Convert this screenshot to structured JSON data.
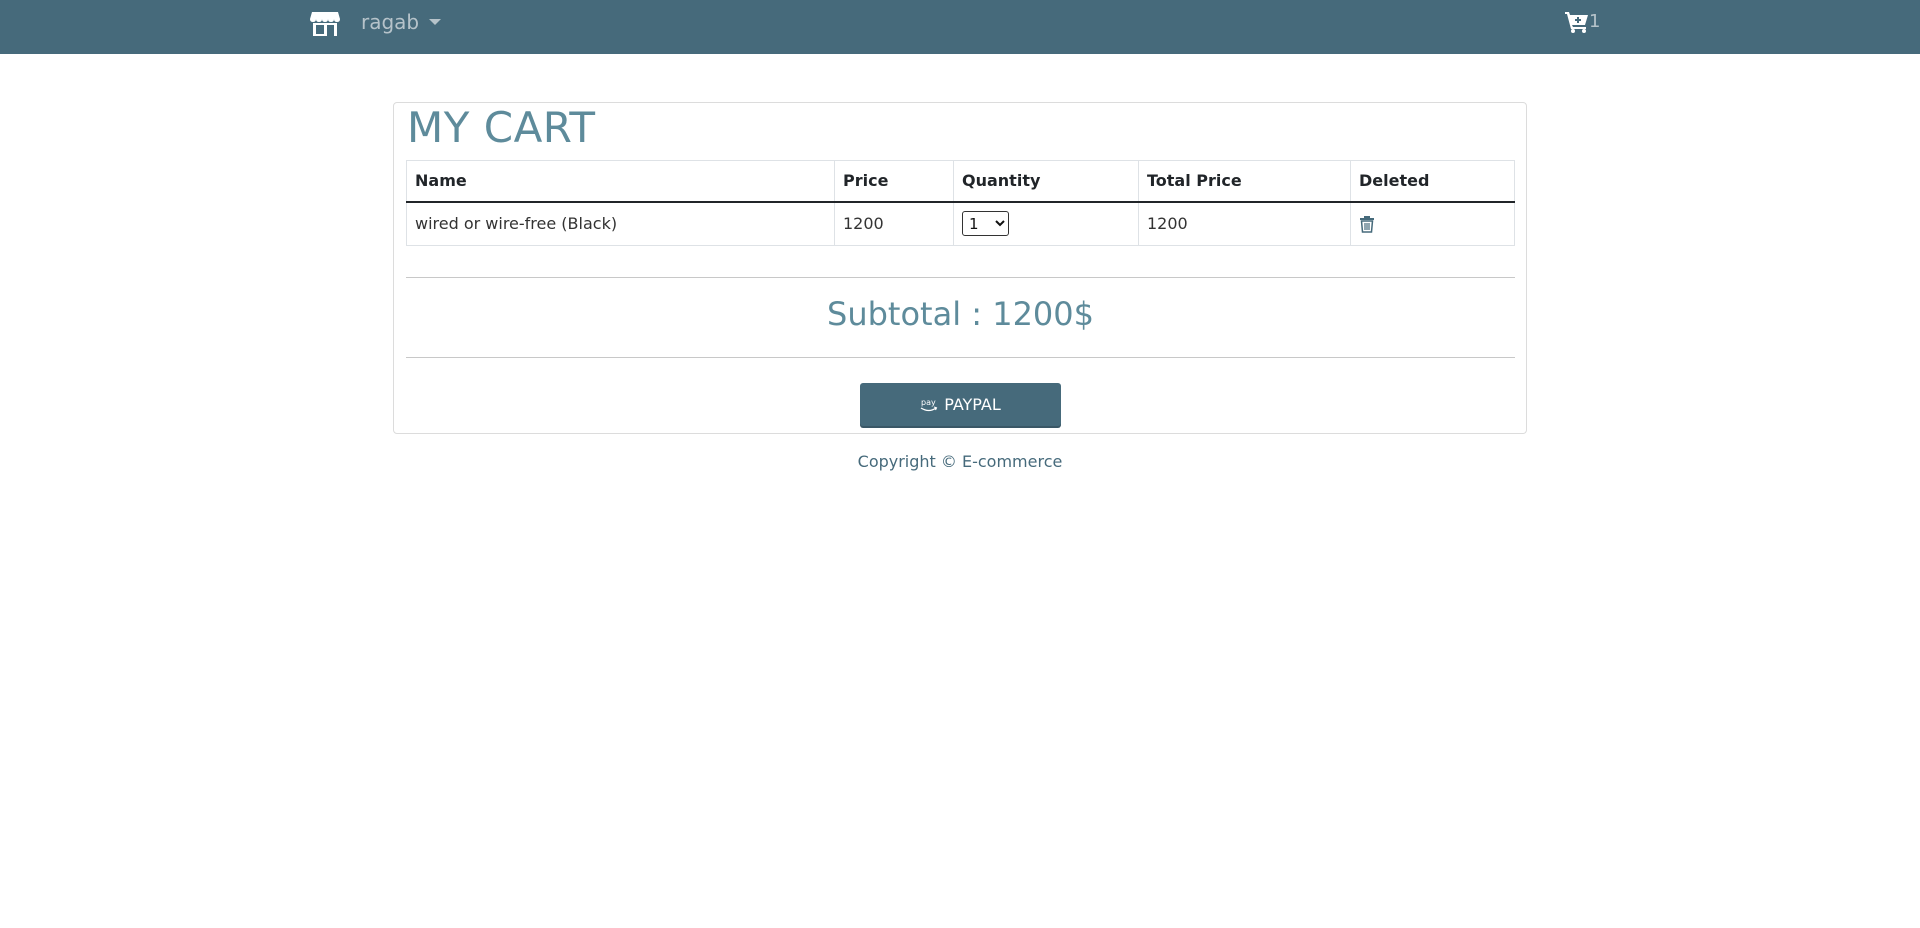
{
  "navbar": {
    "brand_icon": "store-icon",
    "user_name": "ragab",
    "cart_icon": "shopping-cart-icon",
    "cart_count": "1"
  },
  "cart": {
    "title": "MY CART",
    "columns": [
      "Name",
      "Price",
      "Quantity",
      "Total Price",
      "Deleted"
    ],
    "rows": [
      {
        "name": "wired or wire-free (Black)",
        "price": "1200",
        "quantity": "1",
        "total_price": "1200",
        "delete_icon": "trash-icon"
      }
    ],
    "subtotal_label": "Subtotal : ",
    "subtotal_value": "1200$",
    "checkout_label": "PAYPAL",
    "checkout_icon": "amazon-pay-icon"
  },
  "footer": {
    "copyright": "Copyright © E-commerce"
  },
  "colors": {
    "primary": "#466a7b",
    "accent_text": "#5e8b9b"
  }
}
